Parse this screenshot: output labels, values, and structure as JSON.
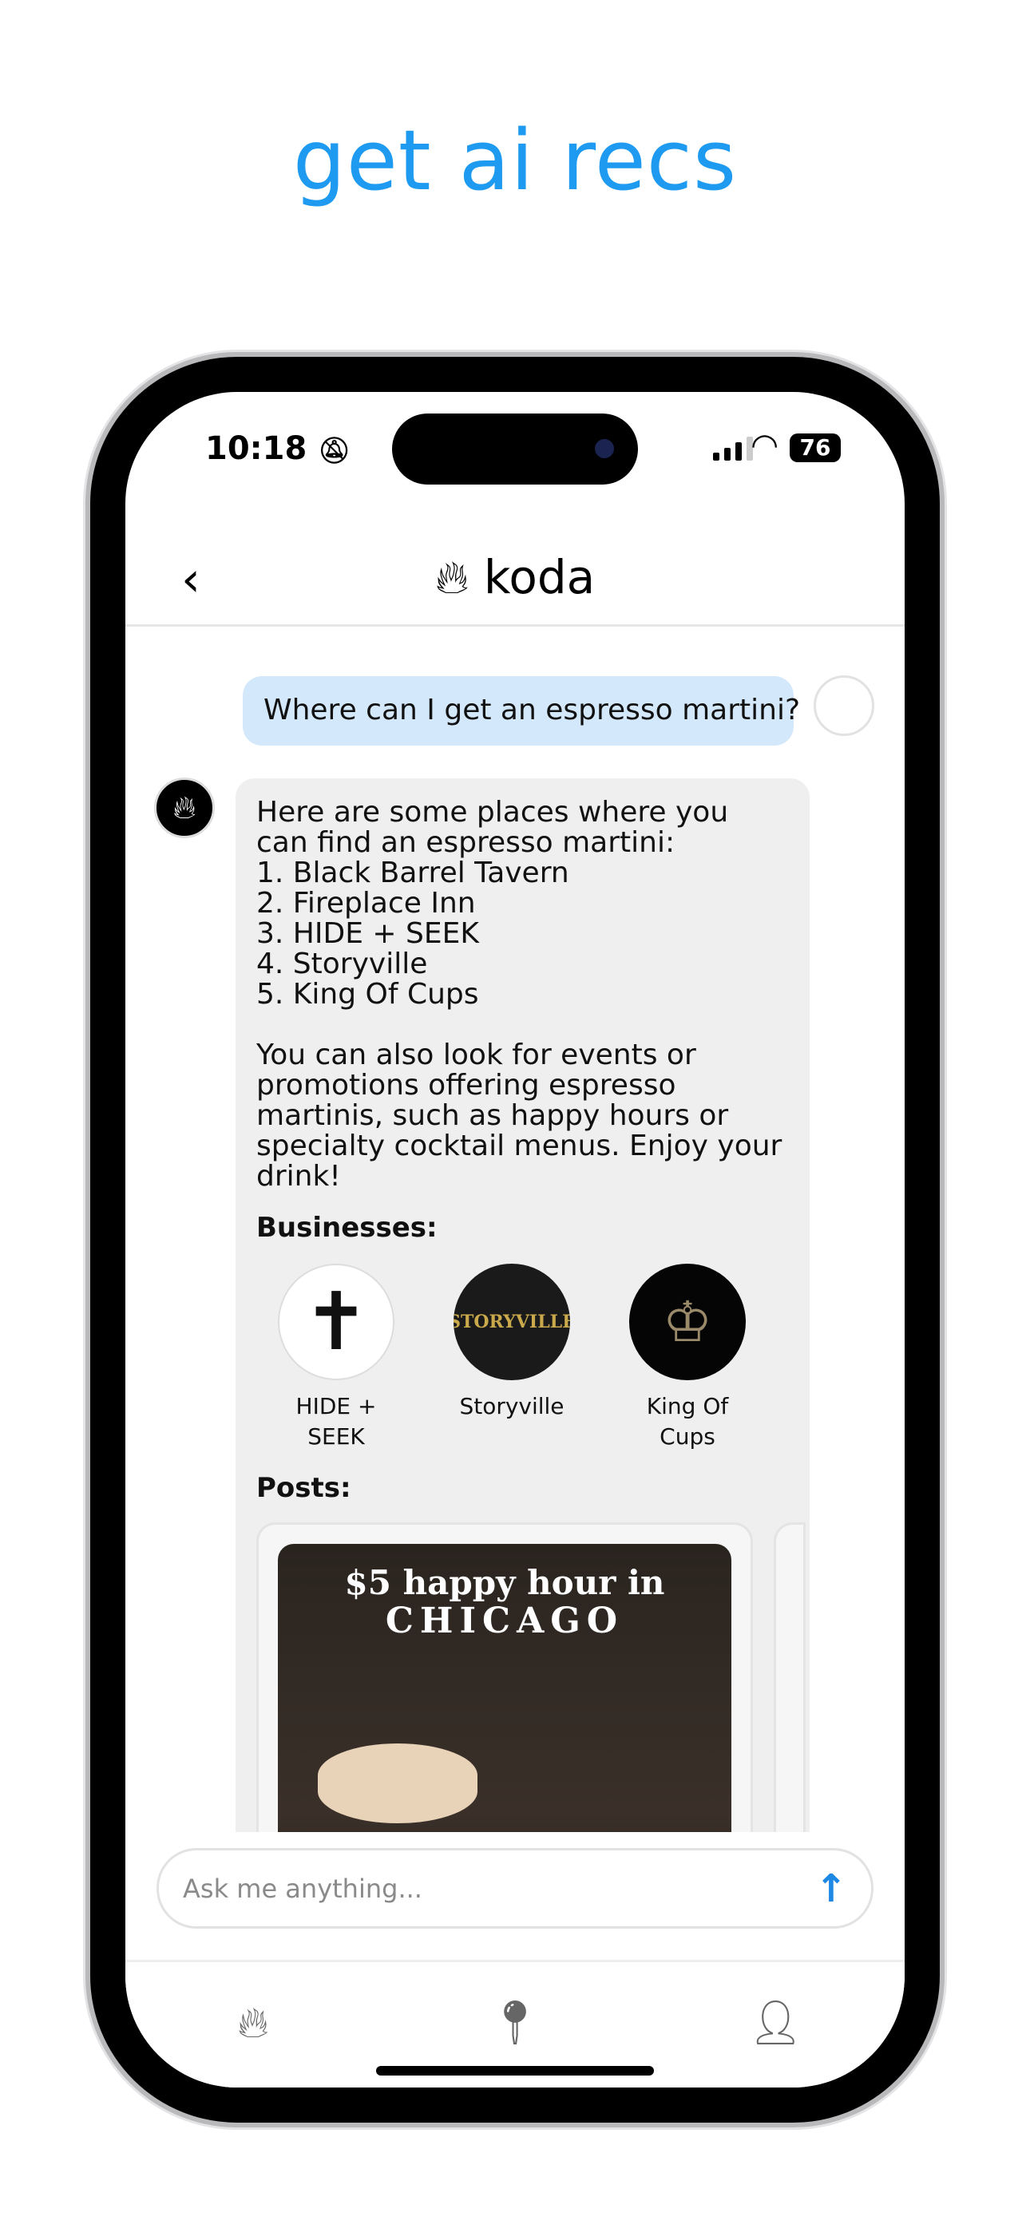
{
  "headline": "get ai recs",
  "status": {
    "time": "10:18",
    "battery": "76",
    "bell_icon": "bell-slash-icon"
  },
  "header": {
    "title": "koda",
    "back_icon": "chevron-left-icon"
  },
  "chat": {
    "user_message": "Where can I get an espresso martini?",
    "bot_message": "Here are some places where you can find an espresso martini:\n1. Black Barrel Tavern\n2. Fireplace Inn\n3. HIDE + SEEK\n4. Storyville\n5. King Of Cups\n\nYou can also look for events or promotions offering espresso martinis, such as happy hours or specialty cocktail menus. Enjoy your drink!",
    "businesses_label": "Businesses:",
    "businesses": [
      {
        "name": "HIDE + SEEK"
      },
      {
        "name": "Storyville",
        "logo_text": "STORYVILLE"
      },
      {
        "name": "King Of Cups"
      }
    ],
    "posts_label": "Posts:",
    "post": {
      "line1": "$5 happy hour in",
      "line2": "CHICAGO"
    }
  },
  "input": {
    "placeholder": "Ask me anything..."
  },
  "tabs": [
    {
      "icon": "flame-icon"
    },
    {
      "icon": "map-pin-icon"
    },
    {
      "icon": "person-icon"
    }
  ],
  "colors": {
    "accent": "#1e9bf0",
    "user_bubble": "#d4e8fc",
    "bot_bubble": "#efefef"
  }
}
